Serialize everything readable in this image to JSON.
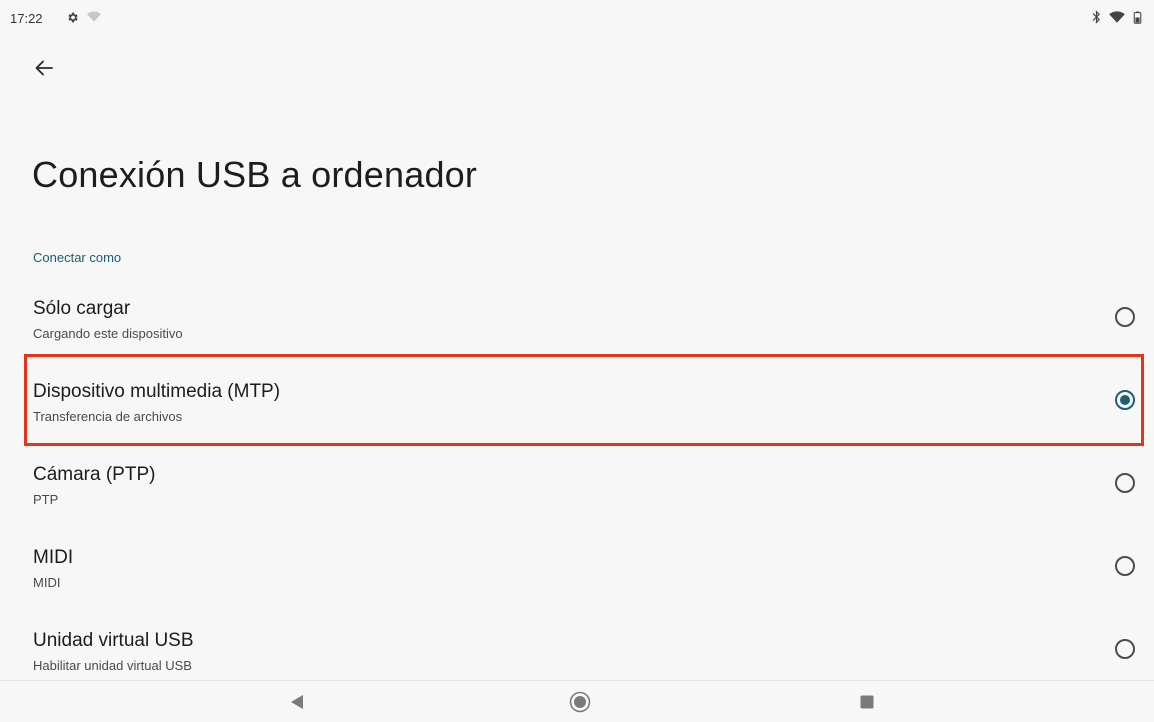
{
  "status_bar": {
    "time": "17:22",
    "icons_left": [
      "gear-icon",
      "wifi-weak-icon"
    ],
    "icons_right": [
      "bluetooth-icon",
      "wifi-icon",
      "battery-icon"
    ]
  },
  "header": {
    "back_icon": "arrow-left-icon",
    "title": "Conexión USB a ordenador"
  },
  "section": {
    "label": "Conectar como"
  },
  "options": [
    {
      "title": "Sólo cargar",
      "subtitle": "Cargando este dispositivo",
      "selected": false
    },
    {
      "title": "Dispositivo multimedia (MTP)",
      "subtitle": "Transferencia de archivos",
      "selected": true
    },
    {
      "title": "Cámara (PTP)",
      "subtitle": "PTP",
      "selected": false
    },
    {
      "title": "MIDI",
      "subtitle": "MIDI",
      "selected": false
    },
    {
      "title": "Unidad virtual USB",
      "subtitle": "Habilitar unidad virtual USB",
      "selected": false
    }
  ],
  "colors": {
    "accent": "#1e5f74",
    "highlight": "#e8331c",
    "background": "#f7f7f7"
  },
  "nav_bar": {
    "icons": [
      "nav-back-icon",
      "nav-home-icon",
      "nav-recents-icon"
    ]
  }
}
